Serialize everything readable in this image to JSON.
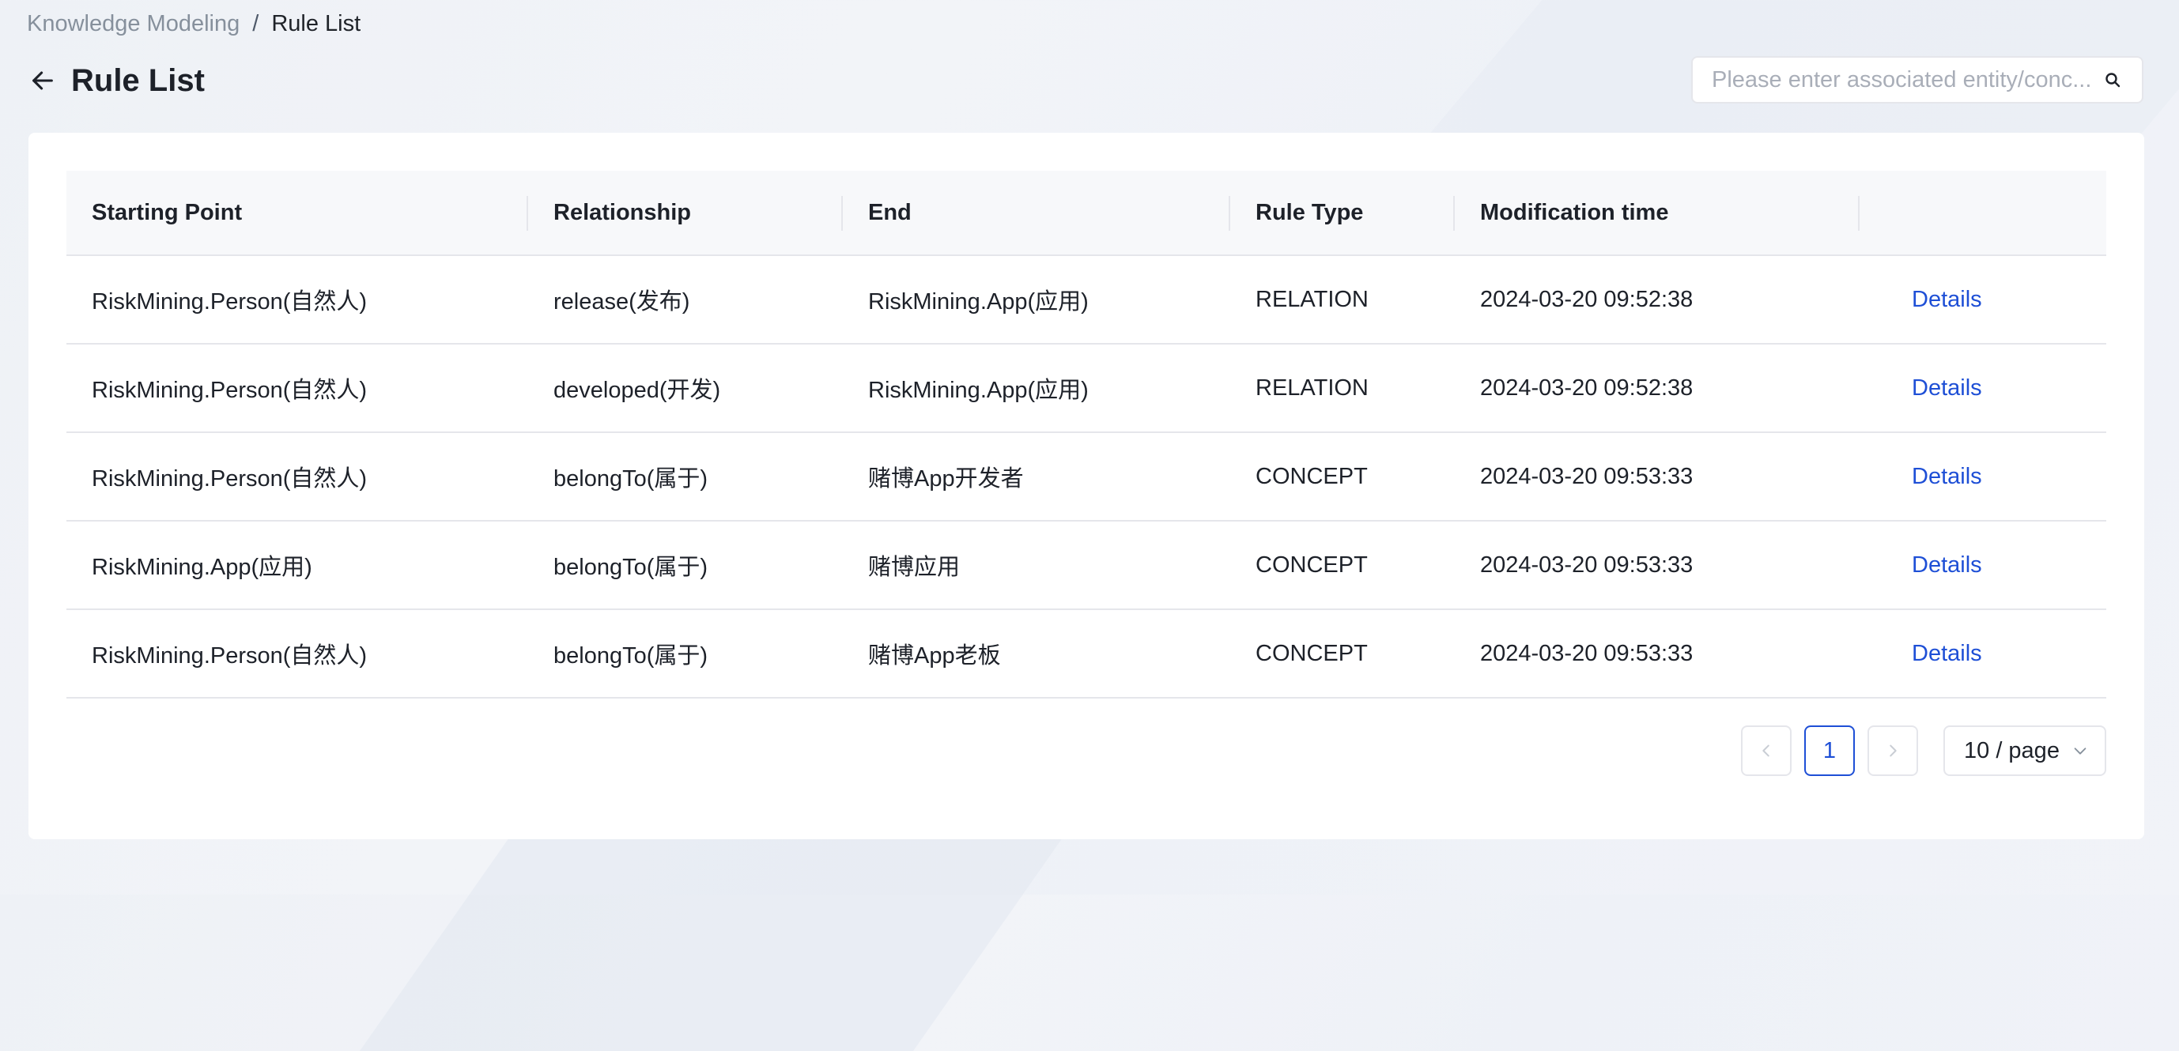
{
  "breadcrumb": {
    "parent": "Knowledge Modeling",
    "separator": "/",
    "current": "Rule List"
  },
  "header": {
    "title": "Rule List"
  },
  "search": {
    "placeholder": "Please enter associated entity/conc...",
    "value": ""
  },
  "table": {
    "columns": [
      "Starting Point",
      "Relationship",
      "End",
      "Rule Type",
      "Modification time",
      ""
    ],
    "rows": [
      {
        "start": "RiskMining.Person(自然人)",
        "relationship": "release(发布)",
        "end": "RiskMining.App(应用)",
        "type": "RELATION",
        "time": "2024-03-20 09:52:38",
        "action": "Details"
      },
      {
        "start": "RiskMining.Person(自然人)",
        "relationship": "developed(开发)",
        "end": "RiskMining.App(应用)",
        "type": "RELATION",
        "time": "2024-03-20 09:52:38",
        "action": "Details"
      },
      {
        "start": "RiskMining.Person(自然人)",
        "relationship": "belongTo(属于)",
        "end": "赌博App开发者",
        "type": "CONCEPT",
        "time": "2024-03-20 09:53:33",
        "action": "Details"
      },
      {
        "start": "RiskMining.App(应用)",
        "relationship": "belongTo(属于)",
        "end": "赌博应用",
        "type": "CONCEPT",
        "time": "2024-03-20 09:53:33",
        "action": "Details"
      },
      {
        "start": "RiskMining.Person(自然人)",
        "relationship": "belongTo(属于)",
        "end": "赌博App老板",
        "type": "CONCEPT",
        "time": "2024-03-20 09:53:33",
        "action": "Details"
      }
    ]
  },
  "pagination": {
    "current_page": "1",
    "page_size": "10 / page"
  },
  "icons": {
    "back": "arrow-left-icon",
    "search": "search-icon",
    "prev": "chevron-left-icon",
    "next": "chevron-right-icon",
    "dropdown": "chevron-down-icon"
  },
  "colors": {
    "link": "#1e4fd6",
    "header_bg": "#f7f8fa",
    "border": "#e5e6eb"
  }
}
